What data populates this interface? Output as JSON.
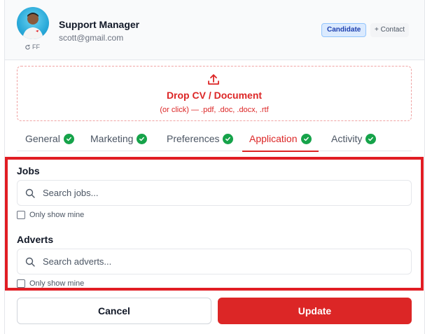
{
  "profile": {
    "name": "Support Manager",
    "email": "scott@gmail.com",
    "initials": "FF",
    "badges": {
      "candidate": "Candidate",
      "add_contact": "+ Contact"
    }
  },
  "dropzone": {
    "title": "Drop CV / Document",
    "subtitle": "(or click) — .pdf, .doc, .docx, .rtf"
  },
  "tabs": [
    {
      "label": "General",
      "complete": true,
      "active": false
    },
    {
      "label": "Marketing",
      "complete": true,
      "active": false
    },
    {
      "label": "Preferences",
      "complete": true,
      "active": false
    },
    {
      "label": "Application",
      "complete": true,
      "active": true
    },
    {
      "label": "Activity",
      "complete": true,
      "active": false
    }
  ],
  "jobs": {
    "label": "Jobs",
    "placeholder": "Search jobs...",
    "value": "",
    "only_mine": "Only show mine"
  },
  "adverts": {
    "label": "Adverts",
    "placeholder": "Search adverts...",
    "value": "",
    "only_mine": "Only show mine"
  },
  "footer": {
    "cancel": "Cancel",
    "update": "Update"
  },
  "colors": {
    "accent": "#dc2626",
    "success": "#16a34a",
    "highlight": "#e11d24"
  }
}
